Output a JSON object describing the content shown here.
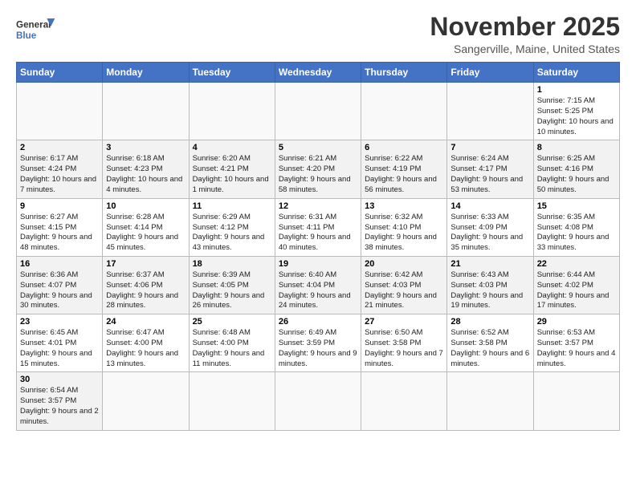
{
  "logo": {
    "text_general": "General",
    "text_blue": "Blue"
  },
  "header": {
    "month": "November 2025",
    "location": "Sangerville, Maine, United States"
  },
  "days_of_week": [
    "Sunday",
    "Monday",
    "Tuesday",
    "Wednesday",
    "Thursday",
    "Friday",
    "Saturday"
  ],
  "weeks": [
    [
      {
        "day": "",
        "info": ""
      },
      {
        "day": "",
        "info": ""
      },
      {
        "day": "",
        "info": ""
      },
      {
        "day": "",
        "info": ""
      },
      {
        "day": "",
        "info": ""
      },
      {
        "day": "",
        "info": ""
      },
      {
        "day": "1",
        "info": "Sunrise: 7:15 AM\nSunset: 5:25 PM\nDaylight: 10 hours and 10 minutes."
      }
    ],
    [
      {
        "day": "2",
        "info": "Sunrise: 6:17 AM\nSunset: 4:24 PM\nDaylight: 10 hours and 7 minutes."
      },
      {
        "day": "3",
        "info": "Sunrise: 6:18 AM\nSunset: 4:23 PM\nDaylight: 10 hours and 4 minutes."
      },
      {
        "day": "4",
        "info": "Sunrise: 6:20 AM\nSunset: 4:21 PM\nDaylight: 10 hours and 1 minute."
      },
      {
        "day": "5",
        "info": "Sunrise: 6:21 AM\nSunset: 4:20 PM\nDaylight: 9 hours and 58 minutes."
      },
      {
        "day": "6",
        "info": "Sunrise: 6:22 AM\nSunset: 4:19 PM\nDaylight: 9 hours and 56 minutes."
      },
      {
        "day": "7",
        "info": "Sunrise: 6:24 AM\nSunset: 4:17 PM\nDaylight: 9 hours and 53 minutes."
      },
      {
        "day": "8",
        "info": "Sunrise: 6:25 AM\nSunset: 4:16 PM\nDaylight: 9 hours and 50 minutes."
      }
    ],
    [
      {
        "day": "9",
        "info": "Sunrise: 6:27 AM\nSunset: 4:15 PM\nDaylight: 9 hours and 48 minutes."
      },
      {
        "day": "10",
        "info": "Sunrise: 6:28 AM\nSunset: 4:14 PM\nDaylight: 9 hours and 45 minutes."
      },
      {
        "day": "11",
        "info": "Sunrise: 6:29 AM\nSunset: 4:12 PM\nDaylight: 9 hours and 43 minutes."
      },
      {
        "day": "12",
        "info": "Sunrise: 6:31 AM\nSunset: 4:11 PM\nDaylight: 9 hours and 40 minutes."
      },
      {
        "day": "13",
        "info": "Sunrise: 6:32 AM\nSunset: 4:10 PM\nDaylight: 9 hours and 38 minutes."
      },
      {
        "day": "14",
        "info": "Sunrise: 6:33 AM\nSunset: 4:09 PM\nDaylight: 9 hours and 35 minutes."
      },
      {
        "day": "15",
        "info": "Sunrise: 6:35 AM\nSunset: 4:08 PM\nDaylight: 9 hours and 33 minutes."
      }
    ],
    [
      {
        "day": "16",
        "info": "Sunrise: 6:36 AM\nSunset: 4:07 PM\nDaylight: 9 hours and 30 minutes."
      },
      {
        "day": "17",
        "info": "Sunrise: 6:37 AM\nSunset: 4:06 PM\nDaylight: 9 hours and 28 minutes."
      },
      {
        "day": "18",
        "info": "Sunrise: 6:39 AM\nSunset: 4:05 PM\nDaylight: 9 hours and 26 minutes."
      },
      {
        "day": "19",
        "info": "Sunrise: 6:40 AM\nSunset: 4:04 PM\nDaylight: 9 hours and 24 minutes."
      },
      {
        "day": "20",
        "info": "Sunrise: 6:42 AM\nSunset: 4:03 PM\nDaylight: 9 hours and 21 minutes."
      },
      {
        "day": "21",
        "info": "Sunrise: 6:43 AM\nSunset: 4:03 PM\nDaylight: 9 hours and 19 minutes."
      },
      {
        "day": "22",
        "info": "Sunrise: 6:44 AM\nSunset: 4:02 PM\nDaylight: 9 hours and 17 minutes."
      }
    ],
    [
      {
        "day": "23",
        "info": "Sunrise: 6:45 AM\nSunset: 4:01 PM\nDaylight: 9 hours and 15 minutes."
      },
      {
        "day": "24",
        "info": "Sunrise: 6:47 AM\nSunset: 4:00 PM\nDaylight: 9 hours and 13 minutes."
      },
      {
        "day": "25",
        "info": "Sunrise: 6:48 AM\nSunset: 4:00 PM\nDaylight: 9 hours and 11 minutes."
      },
      {
        "day": "26",
        "info": "Sunrise: 6:49 AM\nSunset: 3:59 PM\nDaylight: 9 hours and 9 minutes."
      },
      {
        "day": "27",
        "info": "Sunrise: 6:50 AM\nSunset: 3:58 PM\nDaylight: 9 hours and 7 minutes."
      },
      {
        "day": "28",
        "info": "Sunrise: 6:52 AM\nSunset: 3:58 PM\nDaylight: 9 hours and 6 minutes."
      },
      {
        "day": "29",
        "info": "Sunrise: 6:53 AM\nSunset: 3:57 PM\nDaylight: 9 hours and 4 minutes."
      }
    ],
    [
      {
        "day": "30",
        "info": "Sunrise: 6:54 AM\nSunset: 3:57 PM\nDaylight: 9 hours and 2 minutes."
      },
      {
        "day": "",
        "info": ""
      },
      {
        "day": "",
        "info": ""
      },
      {
        "day": "",
        "info": ""
      },
      {
        "day": "",
        "info": ""
      },
      {
        "day": "",
        "info": ""
      },
      {
        "day": "",
        "info": ""
      }
    ]
  ]
}
